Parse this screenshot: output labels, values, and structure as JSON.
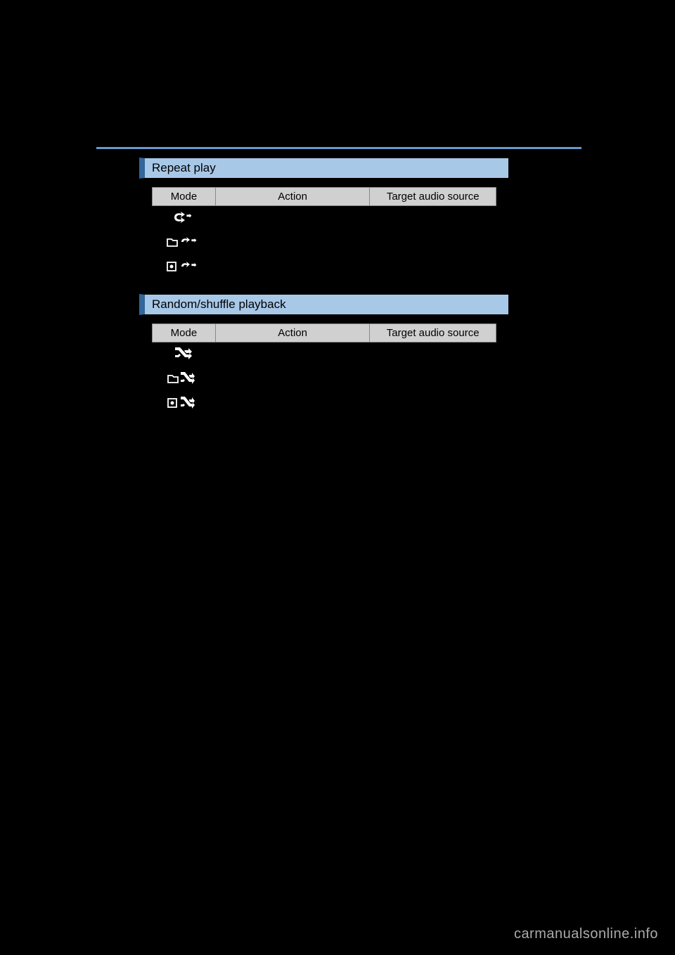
{
  "sections": [
    {
      "title": "Repeat play",
      "headers": [
        "Mode",
        "Action",
        "Target audio source"
      ],
      "rows": [
        {
          "icon": "repeat",
          "action": "",
          "target": ""
        },
        {
          "icon": "folder-repeat",
          "action": "",
          "target": ""
        },
        {
          "icon": "disc-repeat",
          "action": "",
          "target": ""
        }
      ]
    },
    {
      "title": "Random/shuffle playback",
      "headers": [
        "Mode",
        "Action",
        "Target audio source"
      ],
      "rows": [
        {
          "icon": "shuffle",
          "action": "",
          "target": ""
        },
        {
          "icon": "folder-shuffle",
          "action": "",
          "target": ""
        },
        {
          "icon": "disc-shuffle",
          "action": "",
          "target": ""
        }
      ]
    }
  ],
  "watermark": "carmanualsonline.info"
}
